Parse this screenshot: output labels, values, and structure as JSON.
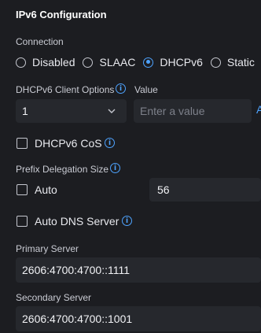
{
  "title": "IPv6 Configuration",
  "connection": {
    "label": "Connection",
    "options": [
      "Disabled",
      "SLAAC",
      "DHCPv6",
      "Static"
    ],
    "selected": "DHCPv6"
  },
  "client_options": {
    "label": "DHCPv6 Client Options",
    "value_label": "Value",
    "select_value": "1",
    "value_placeholder": "Enter a value",
    "add_glyph": "A"
  },
  "cos": {
    "label": "DHCPv6 CoS",
    "checked": false
  },
  "prefix": {
    "label": "Prefix Delegation Size",
    "auto_label": "Auto",
    "auto_checked": false,
    "value": "56"
  },
  "auto_dns": {
    "label": "Auto DNS Server",
    "checked": false
  },
  "primary": {
    "label": "Primary Server",
    "value": "2606:4700:4700::1111"
  },
  "secondary": {
    "label": "Secondary Server",
    "value": "2606:4700:4700::1001"
  },
  "colors": {
    "accent": "#4ea3ff",
    "background": "#1c1d21",
    "field": "#26282d"
  },
  "icons": {
    "info": "info-icon",
    "chevron": "chevron-down-icon"
  }
}
